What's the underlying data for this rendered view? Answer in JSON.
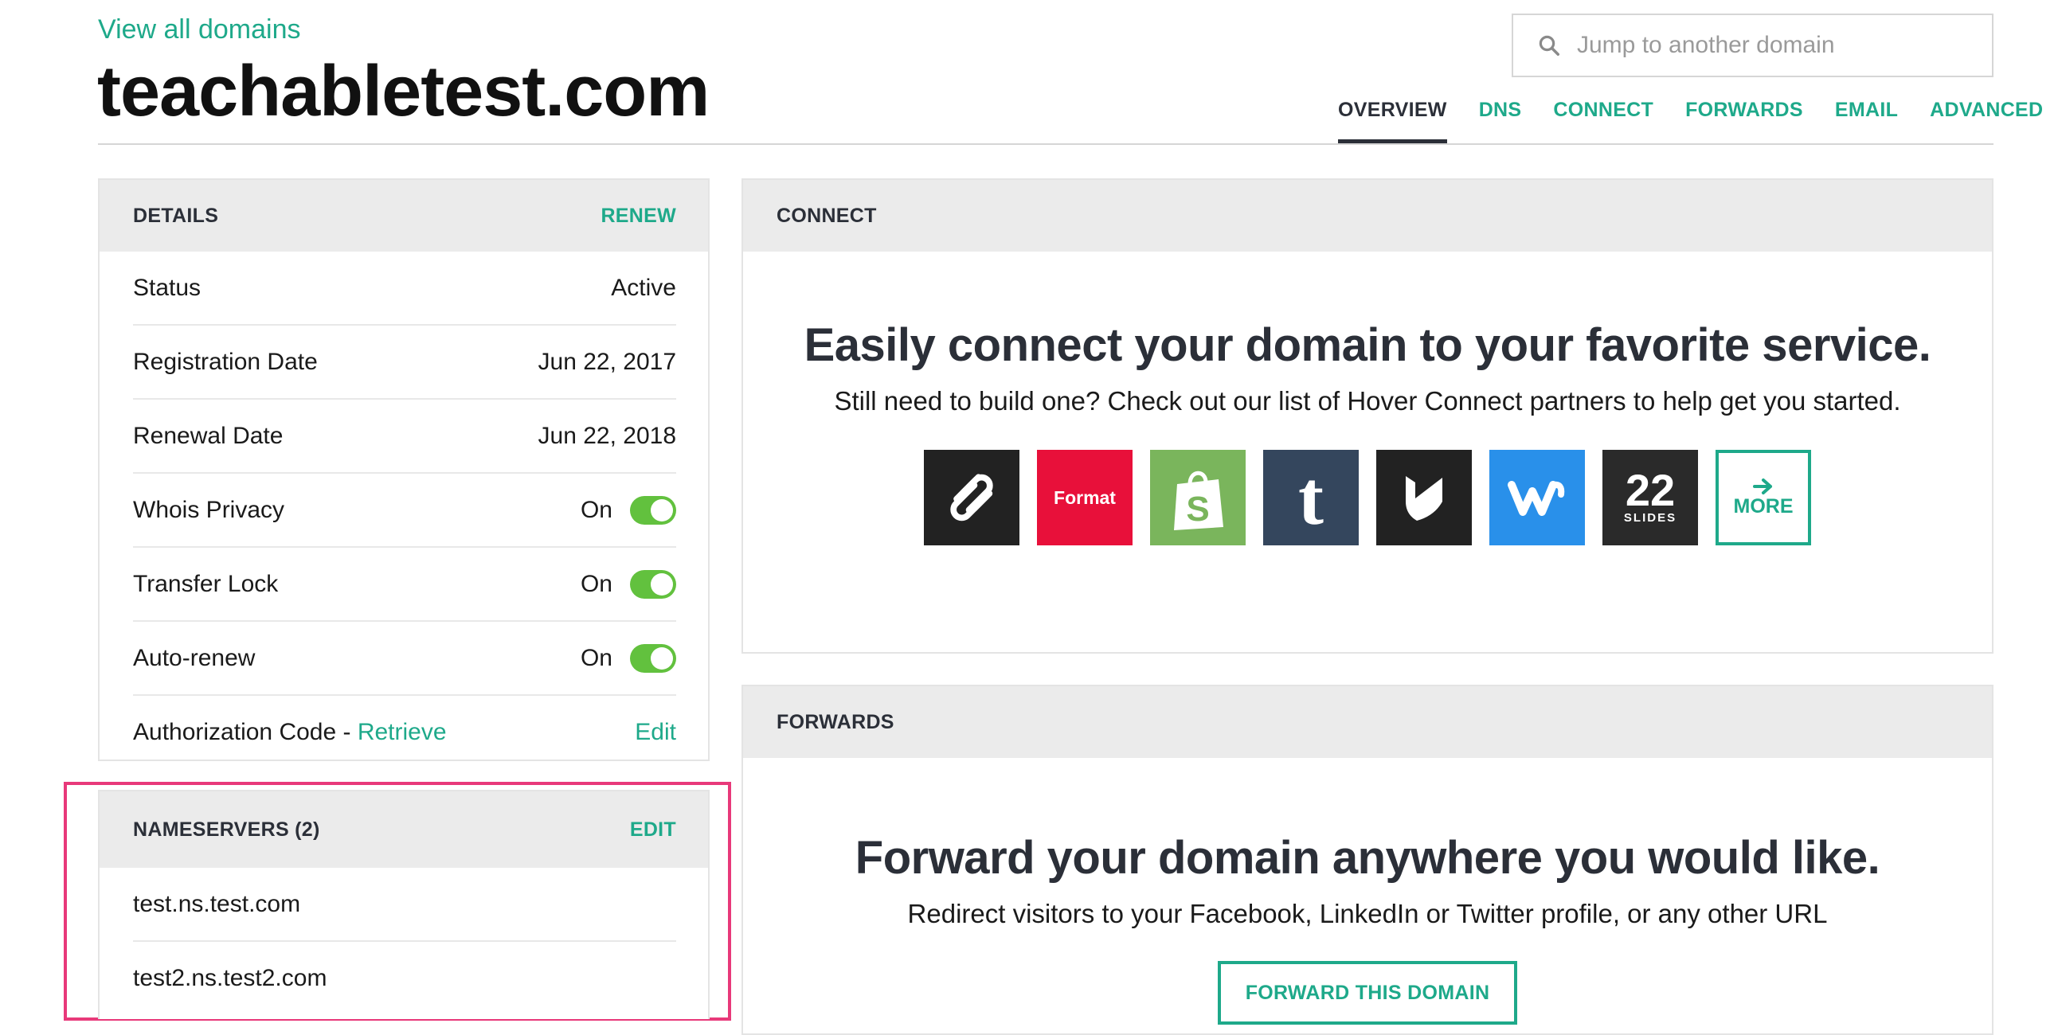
{
  "header": {
    "back_link": "View all domains",
    "domain": "teachabletest.com",
    "search_placeholder": "Jump to another domain",
    "tabs": [
      {
        "label": "OVERVIEW",
        "active": true
      },
      {
        "label": "DNS"
      },
      {
        "label": "CONNECT"
      },
      {
        "label": "FORWARDS"
      },
      {
        "label": "EMAIL"
      },
      {
        "label": "ADVANCED"
      }
    ]
  },
  "details": {
    "title": "DETAILS",
    "action": "RENEW",
    "rows": [
      {
        "label": "Status",
        "value": "Active"
      },
      {
        "label": "Registration Date",
        "value": "Jun 22, 2017"
      },
      {
        "label": "Renewal Date",
        "value": "Jun 22, 2018"
      },
      {
        "label": "Whois Privacy",
        "value": "On",
        "toggle": true
      },
      {
        "label": "Transfer Lock",
        "value": "On",
        "toggle": true
      },
      {
        "label": "Auto-renew",
        "value": "On",
        "toggle": true
      }
    ],
    "auth_code": {
      "label": "Authorization Code - ",
      "link": "Retrieve",
      "action": "Edit"
    }
  },
  "nameservers": {
    "title": "NAMESERVERS (2)",
    "action": "EDIT",
    "items": [
      "test.ns.test.com",
      "test2.ns.test2.com"
    ]
  },
  "connect": {
    "title": "CONNECT",
    "headline": "Easily connect your domain to your favorite service.",
    "subline": "Still need to build one? Check out our list of Hover Connect partners to help get you started.",
    "partners": [
      {
        "name": "squarespace-logo",
        "color": "#222222"
      },
      {
        "name": "format-logo",
        "text": "Format",
        "color": "#e8103a"
      },
      {
        "name": "shopify-logo",
        "color": "#7ab55c"
      },
      {
        "name": "tumblr-logo",
        "text": "t",
        "color": "#34465d"
      },
      {
        "name": "bigcartel-logo",
        "color": "#222222"
      },
      {
        "name": "weebly-logo",
        "color": "#2990ea"
      },
      {
        "name": "22slides-logo",
        "text": "22",
        "subtext": "SLIDES",
        "color": "#2a2a2a"
      }
    ],
    "more_label": "MORE"
  },
  "forwards": {
    "title": "FORWARDS",
    "headline": "Forward your domain anywhere you would like.",
    "subline": "Redirect visitors to your Facebook, LinkedIn or Twitter profile, or any other URL",
    "button": "FORWARD THIS DOMAIN"
  },
  "colors": {
    "accent": "#1ea98a",
    "toggle_on": "#62c13e",
    "highlight": "#e8397a",
    "panel_header": "#ebebeb"
  }
}
